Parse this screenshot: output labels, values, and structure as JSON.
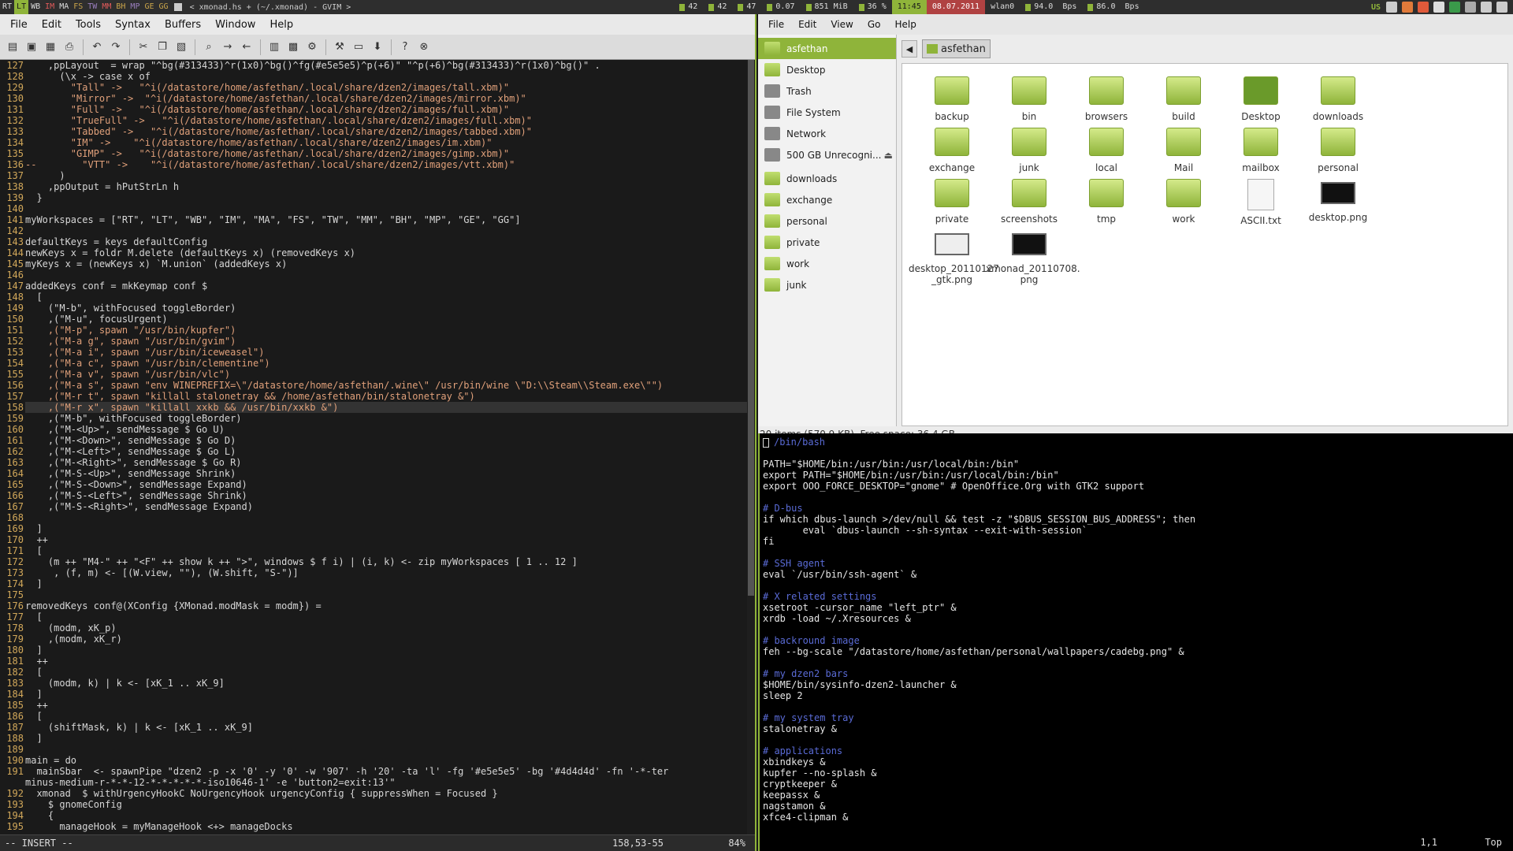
{
  "topbar": {
    "workspaces": [
      "RT",
      "LT",
      "WB",
      "IM",
      "MA",
      "FS",
      "TW",
      "MM",
      "BH",
      "MP",
      "GE",
      "GG"
    ],
    "window_title": "< xmonad.hs + (~/.xmonad) - GVIM >",
    "stats": [
      "42",
      "42",
      "47",
      "0.07",
      "851 MiB",
      "36 %"
    ],
    "time": "11:45",
    "date": "08.07.2011",
    "iface": "wlan0",
    "down": "94.0",
    "down_unit": "Bps",
    "up": "86.0",
    "up_unit": "Bps",
    "layout": "US"
  },
  "gvim": {
    "menu": [
      "File",
      "Edit",
      "Tools",
      "Syntax",
      "Buffers",
      "Window",
      "Help"
    ],
    "status_mode": "-- INSERT --",
    "status_pos": "158,53-55",
    "status_pct": "84%",
    "lines": [
      {
        "n": "127",
        "t": "    ,ppLayout  = wrap \"^bg(#313433)^r(1x0)^bg()^fg(#e5e5e5)^p(+6)\" \"^p(+6)^bg(#313433)^r(1x0)^bg()\" ."
      },
      {
        "n": "128",
        "t": "      (\\x -> case x of"
      },
      {
        "n": "129",
        "t": "        \"Tall\" ->   \"^i(/datastore/home/asfethan/.local/share/dzen2/images/tall.xbm)\""
      },
      {
        "n": "130",
        "t": "        \"Mirror\" ->  \"^i(/datastore/home/asfethan/.local/share/dzen2/images/mirror.xbm)\""
      },
      {
        "n": "131",
        "t": "        \"Full\" ->   \"^i(/datastore/home/asfethan/.local/share/dzen2/images/full.xbm)\""
      },
      {
        "n": "132",
        "t": "        \"TrueFull\" ->   \"^i(/datastore/home/asfethan/.local/share/dzen2/images/full.xbm)\""
      },
      {
        "n": "133",
        "t": "        \"Tabbed\" ->   \"^i(/datastore/home/asfethan/.local/share/dzen2/images/tabbed.xbm)\""
      },
      {
        "n": "134",
        "t": "        \"IM\" ->    \"^i(/datastore/home/asfethan/.local/share/dzen2/images/im.xbm)\""
      },
      {
        "n": "135",
        "t": "        \"GIMP\" ->   \"^i(/datastore/home/asfethan/.local/share/dzen2/images/gimp.xbm)\""
      },
      {
        "n": "136",
        "t": "--        \"VTT\" ->    \"^i(/datastore/home/asfethan/.local/share/dzen2/images/vtt.xbm)\""
      },
      {
        "n": "137",
        "t": "      )"
      },
      {
        "n": "138",
        "t": "    ,ppOutput = hPutStrLn h"
      },
      {
        "n": "139",
        "t": "  }"
      },
      {
        "n": "140",
        "t": ""
      },
      {
        "n": "141",
        "t": "myWorkspaces = [\"RT\", \"LT\", \"WB\", \"IM\", \"MA\", \"FS\", \"TW\", \"MM\", \"BH\", \"MP\", \"GE\", \"GG\"]"
      },
      {
        "n": "142",
        "t": ""
      },
      {
        "n": "143",
        "t": "defaultKeys = keys defaultConfig"
      },
      {
        "n": "144",
        "t": "newKeys x = foldr M.delete (defaultKeys x) (removedKeys x)"
      },
      {
        "n": "145",
        "t": "myKeys x = (newKeys x) `M.union` (addedKeys x)"
      },
      {
        "n": "146",
        "t": ""
      },
      {
        "n": "147",
        "t": "addedKeys conf = mkKeymap conf $"
      },
      {
        "n": "148",
        "t": "  ["
      },
      {
        "n": "149",
        "t": "    (\"M-b\", withFocused toggleBorder)"
      },
      {
        "n": "150",
        "t": "    ,(\"M-u\", focusUrgent)"
      },
      {
        "n": "151",
        "t": "    ,(\"M-p\", spawn \"/usr/bin/kupfer\")"
      },
      {
        "n": "152",
        "t": "    ,(\"M-a g\", spawn \"/usr/bin/gvim\")"
      },
      {
        "n": "153",
        "t": "    ,(\"M-a i\", spawn \"/usr/bin/iceweasel\")"
      },
      {
        "n": "154",
        "t": "    ,(\"M-a c\", spawn \"/usr/bin/clementine\")"
      },
      {
        "n": "155",
        "t": "    ,(\"M-a v\", spawn \"/usr/bin/vlc\")"
      },
      {
        "n": "156",
        "t": "    ,(\"M-a s\", spawn \"env WINEPREFIX=\\\"/datastore/home/asfethan/.wine\\\" /usr/bin/wine \\\"D:\\\\Steam\\\\Steam.exe\\\"\")"
      },
      {
        "n": "157",
        "t": "    ,(\"M-r t\", spawn \"killall stalonetray && /home/asfethan/bin/stalonetray &\")"
      },
      {
        "n": "158",
        "t": "    ,(\"M-r x\", spawn \"killall xxkb && /usr/bin/xxkb &\")"
      },
      {
        "n": "159",
        "t": "    ,(\"M-b\", withFocused toggleBorder)"
      },
      {
        "n": "160",
        "t": "    ,(\"M-<Up>\", sendMessage $ Go U)"
      },
      {
        "n": "161",
        "t": "    ,(\"M-<Down>\", sendMessage $ Go D)"
      },
      {
        "n": "162",
        "t": "    ,(\"M-<Left>\", sendMessage $ Go L)"
      },
      {
        "n": "163",
        "t": "    ,(\"M-<Right>\", sendMessage $ Go R)"
      },
      {
        "n": "164",
        "t": "    ,(\"M-S-<Up>\", sendMessage Shrink)"
      },
      {
        "n": "165",
        "t": "    ,(\"M-S-<Down>\", sendMessage Expand)"
      },
      {
        "n": "166",
        "t": "    ,(\"M-S-<Left>\", sendMessage Shrink)"
      },
      {
        "n": "167",
        "t": "    ,(\"M-S-<Right>\", sendMessage Expand)"
      },
      {
        "n": "168",
        "t": ""
      },
      {
        "n": "169",
        "t": "  ]"
      },
      {
        "n": "170",
        "t": "  ++"
      },
      {
        "n": "171",
        "t": "  ["
      },
      {
        "n": "172",
        "t": "    (m ++ \"M4-\" ++ \"<F\" ++ show k ++ \">\", windows $ f i) | (i, k) <- zip myWorkspaces [ 1 .. 12 ]"
      },
      {
        "n": "173",
        "t": "     , (f, m) <- [(W.view, \"\"), (W.shift, \"S-\")]"
      },
      {
        "n": "174",
        "t": "  ]"
      },
      {
        "n": "175",
        "t": ""
      },
      {
        "n": "176",
        "t": "removedKeys conf@(XConfig {XMonad.modMask = modm}) ="
      },
      {
        "n": "177",
        "t": "  ["
      },
      {
        "n": "178",
        "t": "    (modm, xK_p)"
      },
      {
        "n": "179",
        "t": "    ,(modm, xK_r)"
      },
      {
        "n": "180",
        "t": "  ]"
      },
      {
        "n": "181",
        "t": "  ++"
      },
      {
        "n": "182",
        "t": "  ["
      },
      {
        "n": "183",
        "t": "    (modm, k) | k <- [xK_1 .. xK_9]"
      },
      {
        "n": "184",
        "t": "  ]"
      },
      {
        "n": "185",
        "t": "  ++"
      },
      {
        "n": "186",
        "t": "  ["
      },
      {
        "n": "187",
        "t": "    (shiftMask, k) | k <- [xK_1 .. xK_9]"
      },
      {
        "n": "188",
        "t": "  ]"
      },
      {
        "n": "189",
        "t": ""
      },
      {
        "n": "190",
        "t": "main = do"
      },
      {
        "n": "191",
        "t": "  mainSbar  <- spawnPipe \"dzen2 -p -x '0' -y '0' -w '907' -h '20' -ta 'l' -fg '#e5e5e5' -bg '#4d4d4d' -fn '-*-ter"
      },
      {
        "n": "",
        "t": "minus-medium-r-*-*-12-*-*-*-*-*-iso10646-1' -e 'button2=exit:13'\""
      },
      {
        "n": "192",
        "t": "  xmonad  $ withUrgencyHookC NoUrgencyHook urgencyConfig { suppressWhen = Focused }"
      },
      {
        "n": "193",
        "t": "    $ gnomeConfig"
      },
      {
        "n": "194",
        "t": "    {"
      },
      {
        "n": "195",
        "t": "      manageHook = myManageHook <+> manageDocks"
      }
    ]
  },
  "fm": {
    "menu": [
      "File",
      "Edit",
      "View",
      "Go",
      "Help"
    ],
    "breadcrumb": "asfethan",
    "sidebar": [
      "asfethan",
      "Desktop",
      "Trash",
      "File System",
      "Network",
      "500 GB Unrecogni...",
      "downloads",
      "exchange",
      "personal",
      "private",
      "work",
      "junk"
    ],
    "files": [
      "backup",
      "bin",
      "browsers",
      "build",
      "Desktop",
      "downloads",
      "exchange",
      "junk",
      "local",
      "Mail",
      "mailbox",
      "personal",
      "private",
      "screenshots",
      "tmp",
      "work",
      "ASCII.txt",
      "desktop.png",
      "desktop_20110127\n_gtk.png",
      "xmonad_20110708.\npng"
    ],
    "status": "20 items (570.9 KB), Free space: 36.4 GB"
  },
  "term": {
    "title": "/bin/bash",
    "lines": [
      "PATH=\"$HOME/bin:/usr/bin:/usr/local/bin:/bin\"",
      "export PATH=\"$HOME/bin:/usr/bin:/usr/local/bin:/bin\"",
      "export OOO_FORCE_DESKTOP=\"gnome\" # OpenOffice.Org with GTK2 support",
      "",
      "# D-bus",
      "if which dbus-launch >/dev/null && test -z \"$DBUS_SESSION_BUS_ADDRESS\"; then",
      "       eval `dbus-launch --sh-syntax --exit-with-session`",
      "fi",
      "",
      "# SSH agent",
      "eval `/usr/bin/ssh-agent` &",
      "",
      "# X related settings",
      "xsetroot -cursor_name \"left_ptr\" &",
      "xrdb -load ~/.Xresources &",
      "",
      "# backround image",
      "feh --bg-scale \"/datastore/home/asfethan/personal/wallpapers/cadebg.png\" &",
      "",
      "# my dzen2 bars",
      "$HOME/bin/sysinfo-dzen2-launcher &",
      "sleep 2",
      "",
      "# my system tray",
      "stalonetray &",
      "",
      "# applications",
      "xbindkeys &",
      "kupfer --no-splash &",
      "cryptkeeper &",
      "keepassx &",
      "nagstamon &",
      "xfce4-clipman &"
    ],
    "pos": "1,1",
    "top": "Top"
  }
}
